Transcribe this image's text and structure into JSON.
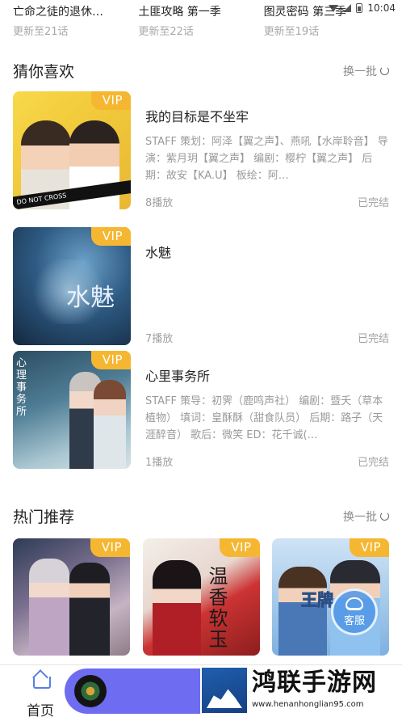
{
  "status_bar": {
    "time": "10:04"
  },
  "continue_row": [
    {
      "title": "亡命之徒的退休…",
      "subtitle": "更新至21话"
    },
    {
      "title": "土匪攻略 第一季",
      "subtitle": "更新至22话"
    },
    {
      "title": "图灵密码 第三季",
      "subtitle": "更新至19话"
    }
  ],
  "guess": {
    "title": "猜你喜欢",
    "refresh_label": "换一批",
    "items": [
      {
        "badge": "VIP",
        "title": "我的目标是不坐牢",
        "desc": "STAFF 策划：阿泽【翼之声】、燕吼【水岸聆音】 导演：紫月玥【翼之声】 编剧：樱柠【翼之声】 后期：故安【KA.U】 板绘：阿…",
        "plays": "8播放",
        "status": "已完结",
        "cover_text": "DO NOT CROSS"
      },
      {
        "badge": "VIP",
        "title": "水魅",
        "desc": "",
        "plays": "7播放",
        "status": "已完结",
        "cover_text": "水魅"
      },
      {
        "badge": "VIP",
        "title": "心里事务所",
        "desc": "STAFF 策导：初霁（鹿鸣声社） 编剧：暨夭（草本植物） 填词：皇酥酥（甜食队员） 后期：路子（天涯醉音） 歌后：微笑 ED：花千诚(…",
        "plays": "1播放",
        "status": "已完结",
        "cover_text": "心理事务所"
      }
    ]
  },
  "hot": {
    "title": "热门推荐",
    "refresh_label": "换一批",
    "cards": [
      {
        "badge": "VIP"
      },
      {
        "badge": "VIP",
        "cover_text": "温香软玉"
      },
      {
        "badge": "VIP",
        "cover_text": "王牌"
      }
    ]
  },
  "floating_service": {
    "label": "客服"
  },
  "bottom_nav": {
    "home_label": "首页"
  },
  "watermark": {
    "title": "鸿联手游网",
    "url": "www.henanhonglian95.com"
  }
}
